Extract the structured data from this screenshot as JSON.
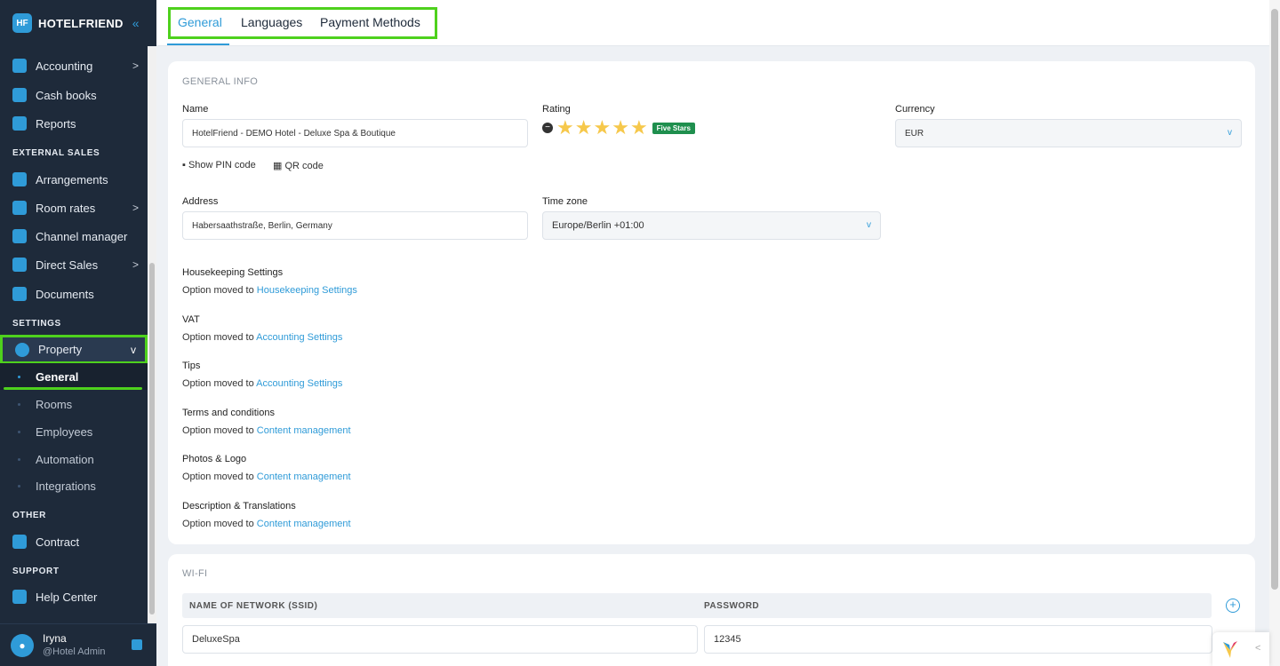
{
  "app": {
    "brand": "HOTELFRIEND",
    "brand_mark": "HF",
    "collapse_glyph": "«"
  },
  "sidebar": {
    "items": [
      {
        "label": "Accounting",
        "has_arrow": true
      },
      {
        "label": "Cash books"
      },
      {
        "label": "Reports"
      },
      {
        "section": "EXTERNAL SALES"
      },
      {
        "label": "Arrangements"
      },
      {
        "label": "Room rates",
        "has_arrow": true
      },
      {
        "label": "Channel manager"
      },
      {
        "label": "Direct Sales",
        "has_arrow": true
      },
      {
        "label": "Documents"
      },
      {
        "section": "SETTINGS"
      },
      {
        "label": "Property",
        "expanded": true
      },
      {
        "section": "OTHER"
      },
      {
        "label": "Contract"
      },
      {
        "section": "SUPPORT"
      },
      {
        "label": "Help Center"
      }
    ],
    "property_sub": [
      "General",
      "Rooms",
      "Employees",
      "Automation",
      "Integrations"
    ],
    "sections": {
      "external_sales": "EXTERNAL SALES",
      "settings": "SETTINGS",
      "other": "OTHER",
      "support": "SUPPORT"
    },
    "user": {
      "name": "Iryna",
      "role": "@Hotel Admin"
    }
  },
  "tabs": [
    "General",
    "Languages",
    "Payment Methods"
  ],
  "general_info": {
    "title": "GENERAL INFO",
    "name_label": "Name",
    "name_value": "HotelFriend - DEMO Hotel - Deluxe Spa & Boutique",
    "rating_label": "Rating",
    "rating_stars": 5,
    "rating_badge": "Five Stars",
    "currency_label": "Currency",
    "currency_value": "EUR",
    "show_pin": "Show PIN code",
    "qr_code": "QR code",
    "address_label": "Address",
    "address_value": "Habersaathstraße, Berlin, Germany",
    "timezone_label": "Time zone",
    "timezone_value": "Europe/Berlin +01:00",
    "moved_prefix": "Option moved to",
    "sections": [
      {
        "title": "Housekeeping Settings",
        "link": "Housekeeping Settings"
      },
      {
        "title": "VAT",
        "link": "Accounting Settings"
      },
      {
        "title": "Tips",
        "link": "Accounting Settings"
      },
      {
        "title": "Terms and conditions",
        "link": "Content management"
      },
      {
        "title": "Photos & Logo",
        "link": "Content management"
      },
      {
        "title": "Description & Translations",
        "link": "Content management"
      }
    ]
  },
  "wifi": {
    "title": "WI-FI",
    "col_ssid": "NAME OF NETWORK (SSID)",
    "col_password": "PASSWORD",
    "ssid_value": "DeluxeSpa",
    "password_value": "12345"
  },
  "colors": {
    "accent": "#2f9bd8",
    "highlight": "#4ed11d",
    "sidebar_bg": "#1e2a3a"
  }
}
